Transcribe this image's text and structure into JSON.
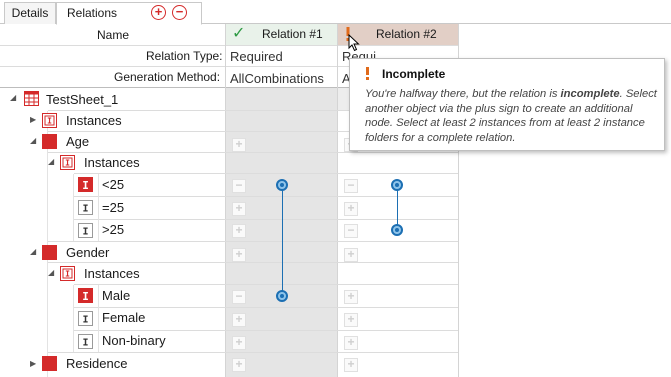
{
  "tabs": [
    {
      "label": "Details",
      "active": false
    },
    {
      "label": "Relations",
      "active": true
    }
  ],
  "tab_actions": {
    "add_symbol": "+",
    "remove_symbol": "−"
  },
  "header": {
    "name_label": "Name",
    "relation_type_label": "Relation Type:",
    "generation_method_label": "Generation Method:"
  },
  "relations": [
    {
      "title": "Relation #1",
      "status": "complete",
      "status_icon": "check-icon",
      "relation_type": "Required",
      "generation_method": "AllCombinations"
    },
    {
      "title": "Relation #2",
      "status": "incomplete",
      "status_icon": "exclamation-icon",
      "relation_type": "Requi",
      "generation_method": "A"
    }
  ],
  "tree": [
    {
      "label": "TestSheet_1",
      "icon": "table-icon",
      "expanded": true
    },
    {
      "label": "Instances",
      "icon": "instance-folder-icon",
      "expanded": false
    },
    {
      "label": "Age",
      "icon": "attribute-icon",
      "expanded": true
    },
    {
      "label": "Instances",
      "icon": "instance-folder-icon",
      "expanded": true
    },
    {
      "label": "<25",
      "icon": "instance-icon"
    },
    {
      "label": "=25",
      "icon": "instance-icon"
    },
    {
      "label": ">25",
      "icon": "instance-icon"
    },
    {
      "label": "Gender",
      "icon": "attribute-icon",
      "expanded": true
    },
    {
      "label": "Instances",
      "icon": "instance-folder-icon",
      "expanded": true
    },
    {
      "label": "Male",
      "icon": "instance-icon"
    },
    {
      "label": "Female",
      "icon": "instance-icon"
    },
    {
      "label": "Non-binary",
      "icon": "instance-icon"
    },
    {
      "label": "Residence",
      "icon": "attribute-icon",
      "expanded": false
    }
  ],
  "tooltip": {
    "title": "Incomplete",
    "body_intro": "You're halfway there, but the relation is ",
    "body_emphasis": "incomplete",
    "body_rest": ". Select another object via the plus sign to create an additional node. Select at least 2 instances from at least 2 instance folders for a complete relation."
  },
  "colors": {
    "accent_blue": "#1c6fb3",
    "red": "#d42a2a",
    "complete_green": "#2e9a44",
    "incomplete_orange": "#e06a1b",
    "relation2_header_bg": "#e2cfc6",
    "relation1_header_bg": "#e9f2ea"
  }
}
